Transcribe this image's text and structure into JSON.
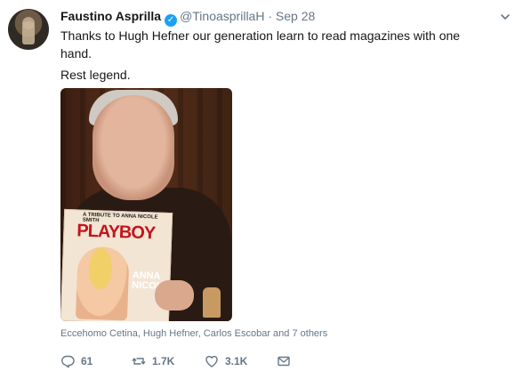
{
  "tweet": {
    "author_name": "Faustino Asprilla",
    "author_handle": "@TinoasprillaH",
    "separator": "·",
    "timestamp": "Sep 28",
    "text_line1": "Thanks to Hugh Hefner our generation learn to read magazines with one hand.",
    "text_line2": "Rest legend.",
    "photo_tags": "Eccehomo Cetina, Hugh Hefner, Carlos Escobar and 7 others",
    "magazine_cover": {
      "banner": "A TRIBUTE TO ANNA NICOLE SMITH",
      "logo": "PLAYBOY",
      "cover_name": "ANNA NICOLE"
    }
  },
  "actions": {
    "reply_count": "61",
    "retweet_count": "1.7K",
    "like_count": "3.1K"
  },
  "icons": {
    "verified": "verified-badge-icon",
    "caret": "chevron-down-icon",
    "reply": "reply-icon",
    "retweet": "retweet-icon",
    "like": "heart-icon",
    "message": "envelope-icon"
  },
  "colors": {
    "text": "#14171a",
    "secondary": "#657786",
    "verified": "#1da1f2"
  }
}
